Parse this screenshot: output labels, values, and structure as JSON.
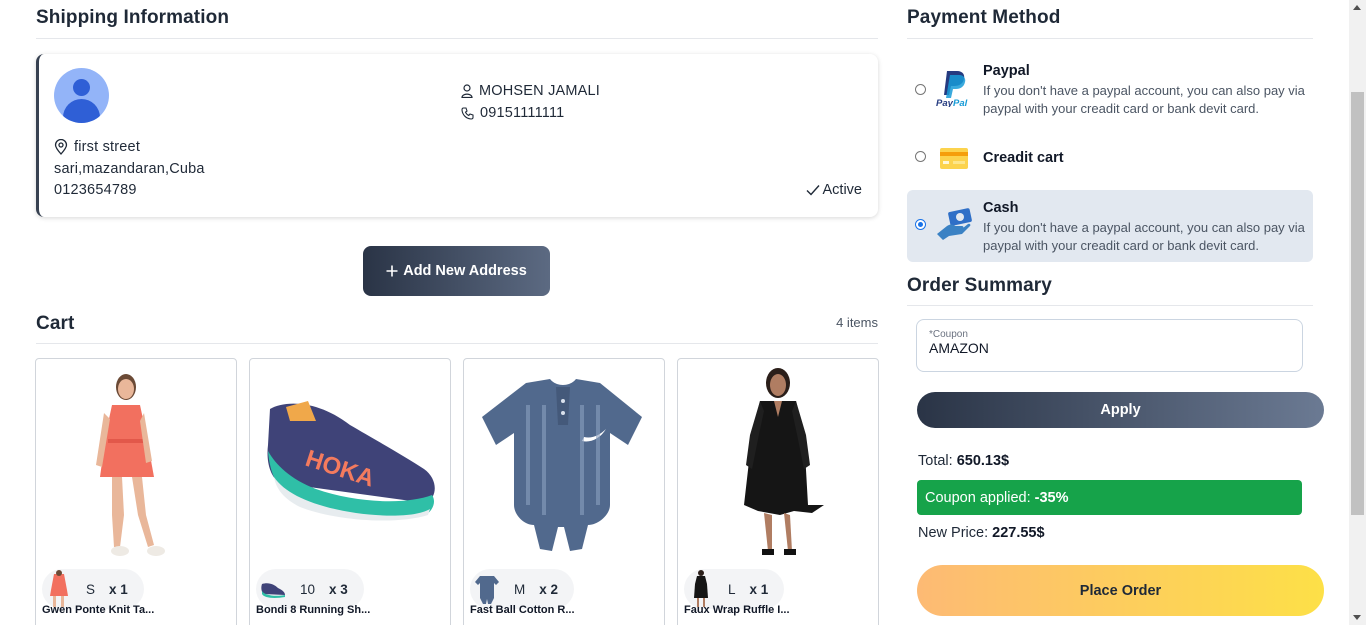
{
  "shipping": {
    "title": "Shipping Information",
    "address": {
      "name": "MOHSEN JAMALI",
      "phone": "09151111111",
      "street": "first street",
      "region": "sari,mazandaran,Cuba",
      "postal": "0123654789",
      "status": "Active"
    },
    "add_button": "Add New Address"
  },
  "cart": {
    "title": "Cart",
    "count": "4 items",
    "items": [
      {
        "size": "S",
        "qty": "x 1",
        "name": "Gwen Ponte Knit Ta..."
      },
      {
        "size": "10",
        "qty": "x 3",
        "name": "Bondi 8 Running Sh..."
      },
      {
        "size": "M",
        "qty": "x 2",
        "name": "Fast Ball Cotton R..."
      },
      {
        "size": "L",
        "qty": "x 1",
        "name": "Faux Wrap Ruffle I..."
      }
    ]
  },
  "payment": {
    "title": "Payment Method",
    "options": [
      {
        "name": "Paypal",
        "desc": "If you don't have a paypal account, you can also pay via paypal with your creadit card or bank devit card.",
        "selected": false,
        "icon": "paypal-icon"
      },
      {
        "name": "Creadit cart",
        "desc": "",
        "selected": false,
        "icon": "credit-card-icon"
      },
      {
        "name": "Cash",
        "desc": "If you don't have a paypal account, you can also pay via paypal with your creadit card or bank devit card.",
        "selected": true,
        "icon": "cash-icon"
      }
    ]
  },
  "summary": {
    "title": "Order Summary",
    "coupon_label": "*Coupon",
    "coupon_value": "AMAZON",
    "apply_button": "Apply",
    "total_label": "Total:",
    "total_value": "650.13$",
    "coupon_applied_label": "Coupon applied:",
    "coupon_applied_value": "-35%",
    "new_price_label": "New Price:",
    "new_price_value": "227.55$",
    "place_order_button": "Place Order"
  },
  "colors": {
    "coupon_applied_bg": "#16a34a",
    "selected_option_bg": "#e2e8f0",
    "primary_dark": "#2a3446",
    "order_gradient_start": "#fdba74",
    "order_gradient_end": "#fde047"
  }
}
